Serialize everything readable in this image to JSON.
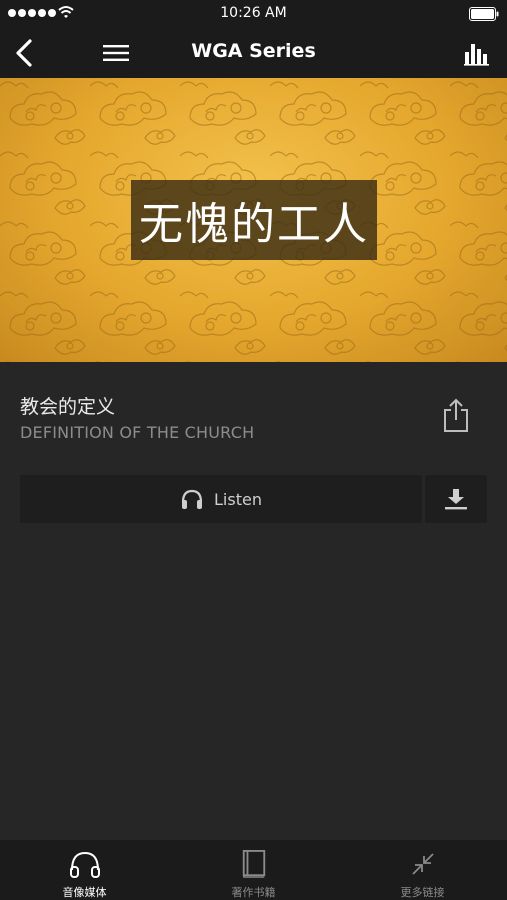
{
  "status_bar": {
    "time": "10:26 AM"
  },
  "nav": {
    "title": "WGA Series",
    "icons": {
      "back": "chevron-left-icon",
      "menu": "hamburger-menu-icon",
      "stats": "bar-chart-icon"
    }
  },
  "banner": {
    "title": "无愧的工人",
    "colors": {
      "gold": "#e5a72d",
      "box": "#3c2d14"
    }
  },
  "sermon": {
    "title": "教会的定义",
    "subtitle": "DEFINITION OF THE CHURCH",
    "share_icon": "share-icon"
  },
  "actions": {
    "listen_label": "Listen",
    "listen_icon": "headphones-icon",
    "download_icon": "download-icon"
  },
  "tabs": [
    {
      "label": "音像媒体",
      "icon": "headphones-icon",
      "active": true
    },
    {
      "label": "著作书籍",
      "icon": "book-icon",
      "active": false
    },
    {
      "label": "更多链接",
      "icon": "collapse-arrows-icon",
      "active": false
    }
  ]
}
